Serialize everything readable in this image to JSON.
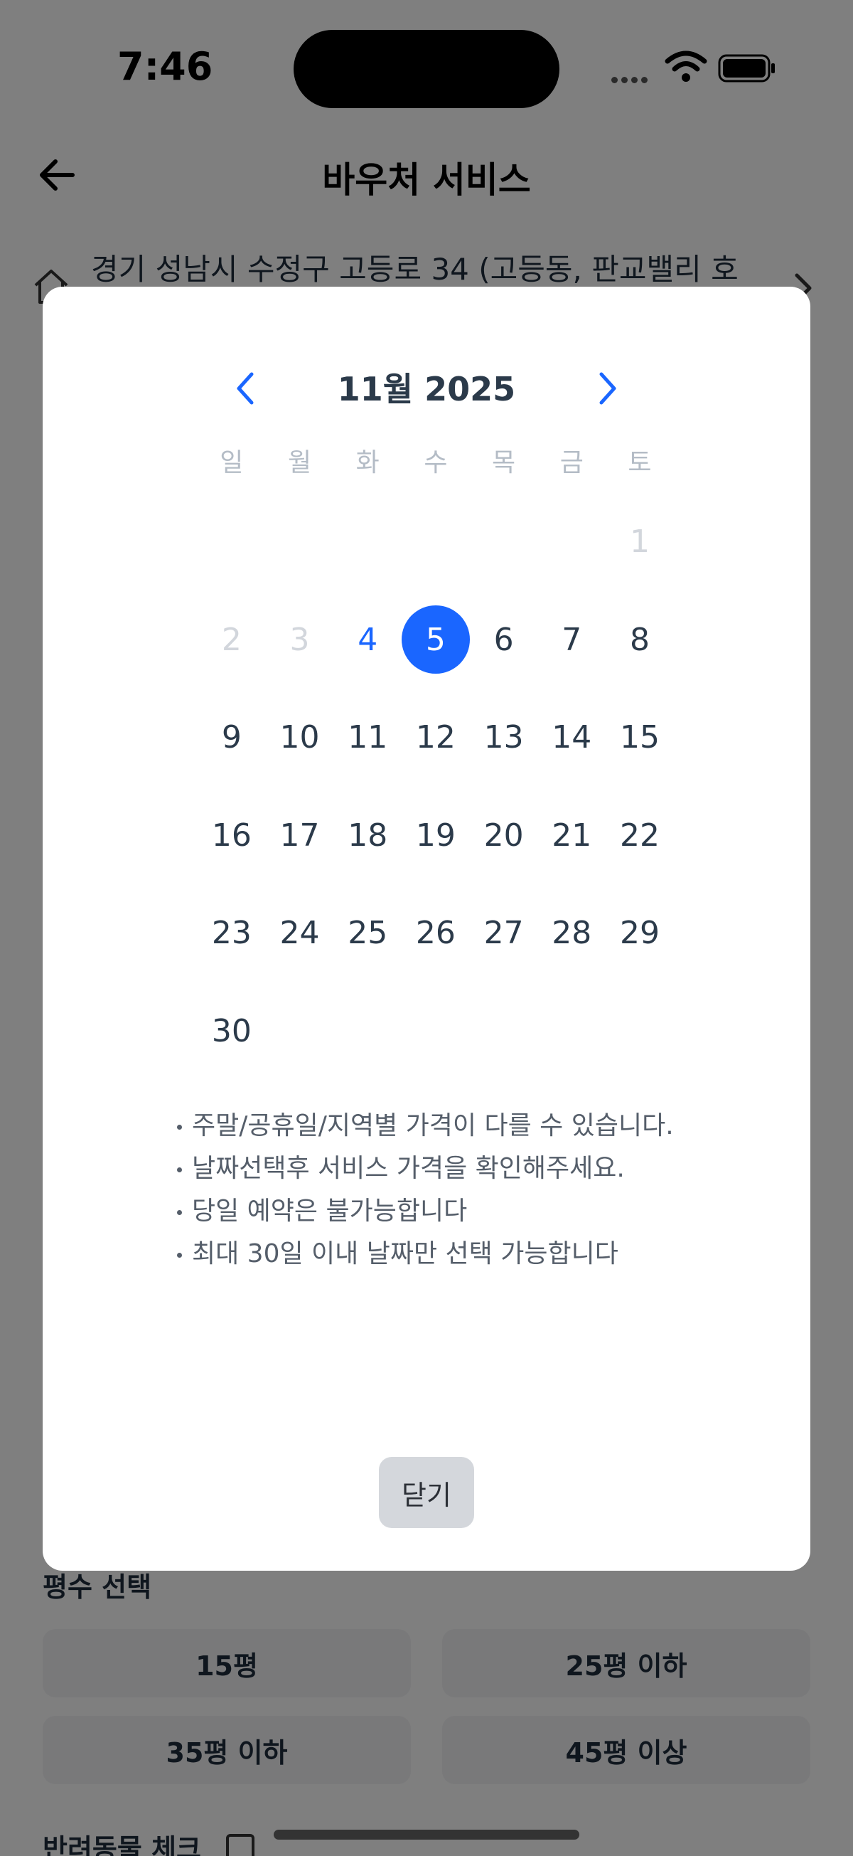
{
  "status_bar": {
    "time": "7:46"
  },
  "header": {
    "title": "바우처 서비스"
  },
  "address": {
    "text": "경기 성남시 수정구 고등로 34 (고등동, 판교밸리 호"
  },
  "size_section": {
    "label": "평수 선택",
    "options": [
      "15평",
      "25평 이하",
      "35평 이하",
      "45평 이상"
    ]
  },
  "pet_section": {
    "label": "반려동물 체크"
  },
  "calendar": {
    "month_title": "11월 2025",
    "weekdays": [
      "일",
      "월",
      "화",
      "수",
      "목",
      "금",
      "토"
    ],
    "first_weekday_index": 6,
    "days_in_month": 30,
    "disabled_days": [
      1,
      2,
      3
    ],
    "today": 4,
    "selected": 5
  },
  "notes": [
    "주말/공휴일/지역별 가격이 다를 수 있습니다.",
    "날짜선택후 서비스 가격을 확인해주세요.",
    "당일 예약은 불가능합니다",
    "최대 30일 이내 날짜만 선택 가능합니다"
  ],
  "close_label": "닫기",
  "colors": {
    "accent": "#1a66ff",
    "overlay": "#000000",
    "button_bg": "#d4d7dc"
  }
}
